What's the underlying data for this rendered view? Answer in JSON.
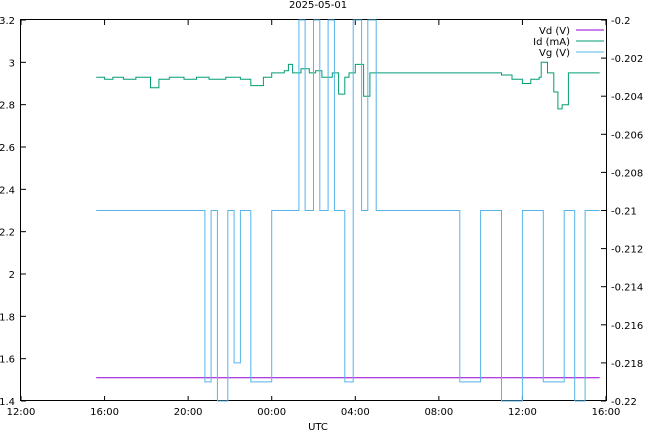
{
  "chart_data": {
    "type": "line",
    "title": "2025-05-01",
    "xlabel": "UTC",
    "ylabel": "",
    "y2label": "",
    "x_ticks": [
      "12:00",
      "16:00",
      "20:00",
      "00:00",
      "04:00",
      "08:00",
      "12:00",
      "16:00"
    ],
    "xlim_hours": [
      12,
      40
    ],
    "ylim": [
      1.4,
      3.2
    ],
    "y_ticks": [
      "1.4",
      "1.6",
      "1.8",
      "2",
      "2.2",
      "2.4",
      "2.6",
      "2.8",
      "3",
      "3.2"
    ],
    "y2lim": [
      -0.22,
      -0.2
    ],
    "y2_ticks": [
      "-0.22",
      "-0.218",
      "-0.216",
      "-0.214",
      "-0.212",
      "-0.21",
      "-0.208",
      "-0.206",
      "-0.204",
      "-0.202",
      "-0.2"
    ],
    "grid": false,
    "legend_position": "top-right",
    "series": [
      {
        "name": "Vd (V)",
        "axis": "left",
        "color": "#9400d3",
        "x_hours": [
          15.6,
          39.7
        ],
        "y": [
          1.51,
          1.51
        ]
      },
      {
        "name": "Id (mA)",
        "axis": "left",
        "color": "#009e73",
        "x_hours": [
          15.6,
          16.0,
          16.4,
          16.9,
          17.5,
          18.2,
          18.6,
          19.1,
          19.8,
          20.4,
          21.0,
          21.8,
          22.5,
          23.0,
          23.2,
          23.6,
          24.0,
          24.3,
          24.6,
          24.8,
          25.0,
          25.4,
          25.8,
          26.1,
          26.4,
          26.9,
          27.2,
          27.5,
          27.7,
          28.0,
          28.4,
          28.7,
          29.0,
          30.0,
          31.0,
          33.0,
          34.0,
          35.0,
          35.5,
          36.0,
          36.4,
          36.8,
          36.9,
          37.2,
          37.5,
          37.7,
          37.9,
          38.2,
          39.7
        ],
        "y": [
          2.93,
          2.92,
          2.93,
          2.92,
          2.93,
          2.88,
          2.92,
          2.93,
          2.92,
          2.93,
          2.92,
          2.93,
          2.92,
          2.89,
          2.89,
          2.93,
          2.95,
          2.95,
          2.96,
          2.99,
          2.95,
          2.97,
          2.95,
          2.96,
          2.93,
          2.95,
          2.85,
          2.93,
          2.95,
          2.99,
          2.84,
          2.95,
          2.95,
          2.95,
          2.95,
          2.95,
          2.95,
          2.94,
          2.92,
          2.9,
          2.92,
          2.93,
          3.0,
          2.95,
          2.86,
          2.78,
          2.8,
          2.95,
          2.95
        ]
      },
      {
        "name": "Vg (V)",
        "axis": "right",
        "color": "#56b4e9",
        "x_hours": [
          15.6,
          20.8,
          21.1,
          21.4,
          21.9,
          22.2,
          22.5,
          23.0,
          24.0,
          25.0,
          25.3,
          25.6,
          26.0,
          26.3,
          26.7,
          27.0,
          27.5,
          27.9,
          28.3,
          28.6,
          29.0,
          30.0,
          31.0,
          32.0,
          33.0,
          34.0,
          35.0,
          36.0,
          37.0,
          38.0,
          38.5,
          39.0,
          39.7
        ],
        "y": [
          -0.21,
          -0.219,
          -0.21,
          -0.22,
          -0.21,
          -0.218,
          -0.21,
          -0.219,
          -0.21,
          -0.21,
          -0.2,
          -0.21,
          -0.2,
          -0.21,
          -0.2,
          -0.21,
          -0.219,
          -0.2,
          -0.21,
          -0.2,
          -0.21,
          -0.21,
          -0.21,
          -0.21,
          -0.219,
          -0.21,
          -0.22,
          -0.21,
          -0.219,
          -0.21,
          -0.22,
          -0.21,
          -0.21
        ]
      }
    ]
  }
}
